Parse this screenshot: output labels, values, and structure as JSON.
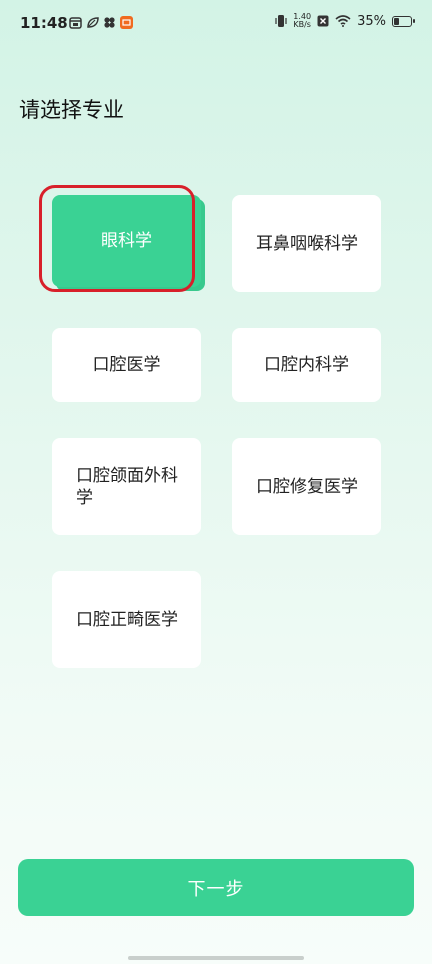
{
  "status_bar": {
    "time": "11:48",
    "speed_value": "1.40",
    "speed_unit": "KB/s",
    "battery": "35%",
    "battery_level": 0.35
  },
  "page": {
    "title": "请选择专业"
  },
  "majors": [
    {
      "label": "眼科学",
      "selected": true
    },
    {
      "label": "耳鼻咽喉科学",
      "selected": false
    },
    {
      "label": "口腔医学",
      "selected": false
    },
    {
      "label": "口腔内科学",
      "selected": false
    },
    {
      "label": "口腔颌面外科学",
      "selected": false
    },
    {
      "label": "口腔修复医学",
      "selected": false
    },
    {
      "label": "口腔正畸医学",
      "selected": false
    }
  ],
  "actions": {
    "next_label": "下一步"
  },
  "colors": {
    "accent": "#3ad294",
    "highlight": "#d8202a"
  },
  "icons": [
    "calendar-icon",
    "leaf-app-icon",
    "clover-app-icon",
    "taobao-app-icon",
    "vibrate-icon",
    "close-box-icon",
    "wifi-icon",
    "battery-icon"
  ]
}
